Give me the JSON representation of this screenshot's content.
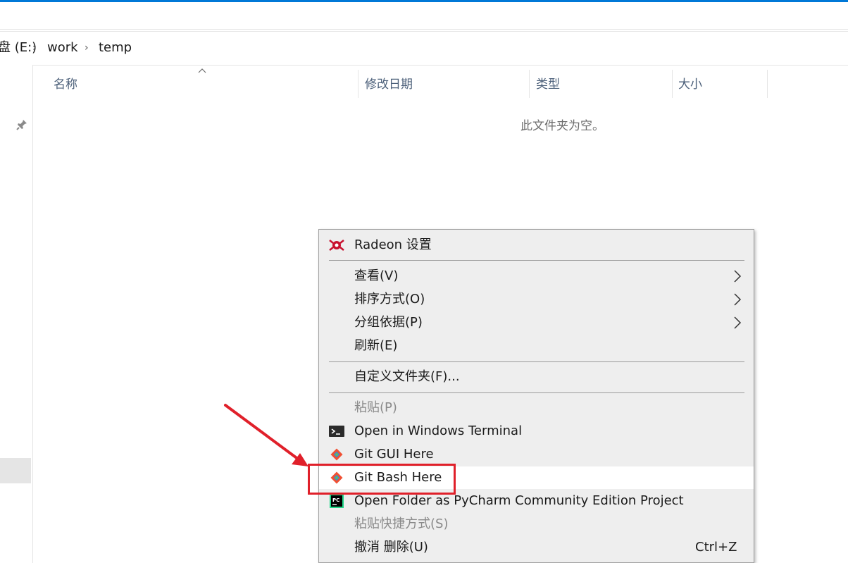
{
  "address_bar": {
    "crumbs": [
      "盘 (E:)",
      "work",
      "temp"
    ],
    "separator": "›"
  },
  "file_list": {
    "columns": [
      "名称",
      "修改日期",
      "类型",
      "大小"
    ],
    "sort_indicator": "^",
    "empty_message": "此文件夹为空。"
  },
  "context_menu": {
    "items": [
      {
        "label": "Radeon 设置",
        "icon": "radeon-icon",
        "disabled": false
      },
      {
        "label": "查看(V)",
        "submenu": true
      },
      {
        "label": "排序方式(O)",
        "submenu": true
      },
      {
        "label": "分组依据(P)",
        "submenu": true
      },
      {
        "label": "刷新(E)"
      },
      {
        "label": "自定义文件夹(F)..."
      },
      {
        "label": "粘贴(P)",
        "disabled": true
      },
      {
        "label": "Open in Windows Terminal",
        "icon": "terminal-icon"
      },
      {
        "label": "Git GUI Here",
        "icon": "git-icon"
      },
      {
        "label": "Git Bash Here",
        "icon": "git-icon",
        "highlighted": true
      },
      {
        "label": "Open Folder as PyCharm Community Edition Project",
        "icon": "pycharm-icon"
      },
      {
        "label": "粘贴快捷方式(S)",
        "disabled": true
      },
      {
        "label": "撤消 删除(U)",
        "shortcut": "Ctrl+Z"
      }
    ]
  },
  "colors": {
    "accent": "#0078d7",
    "annotation": "#e0202a",
    "menu_background": "#eeeeee",
    "highlight_background": "#ffffff"
  }
}
